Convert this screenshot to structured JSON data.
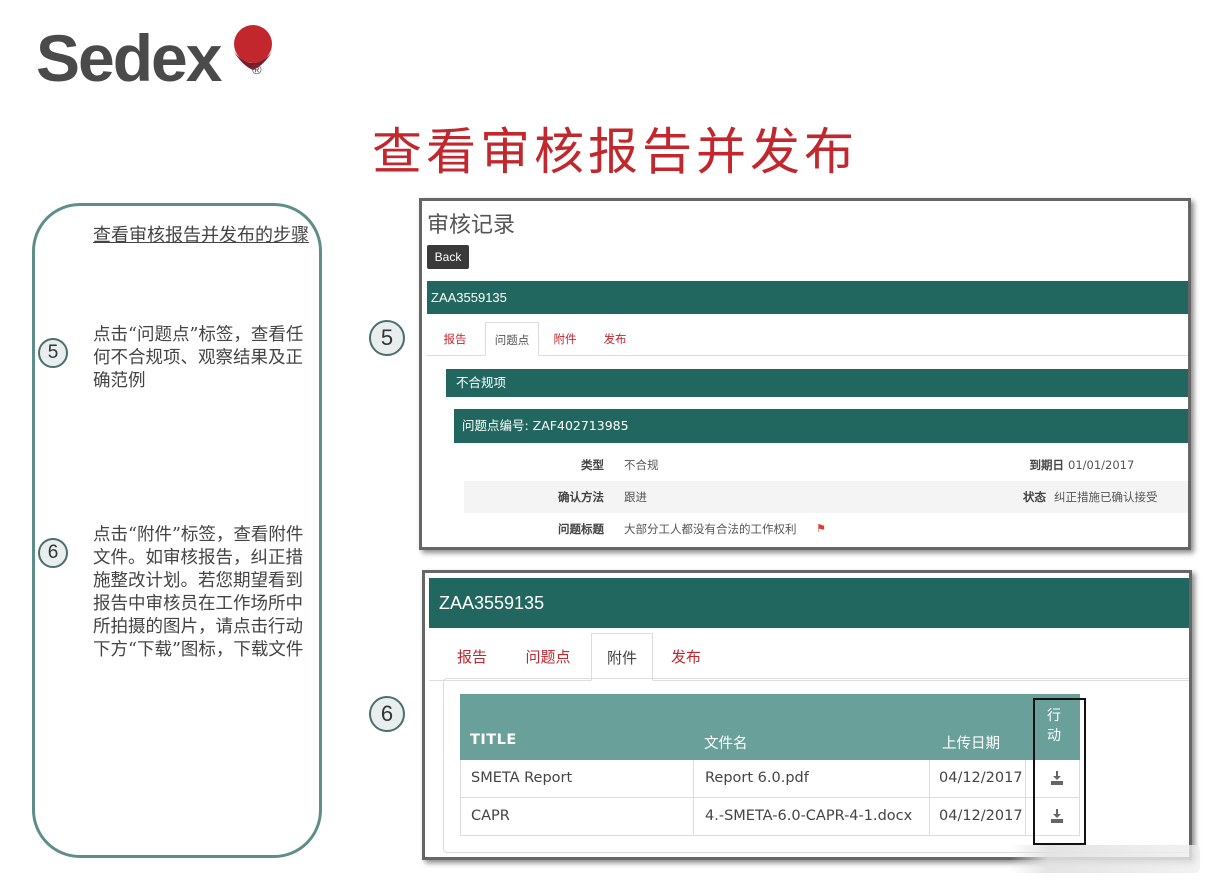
{
  "logo": {
    "text": "Sedex",
    "reg": "®"
  },
  "title": "查看审核报告并发布",
  "steps_panel": {
    "heading": "查看审核报告并发布的步骤",
    "steps": [
      {
        "num": "5",
        "text": "点击“问题点”标签，查看任何不合规项、观察结果及正确范例"
      },
      {
        "num": "6",
        "text": "点击“附件”标签，查看附件文件。如审核报告，纠正措施整改计划。若您期望看到报告中审核员在工作场所中所拍摄的图片，请点击行动下方“下载”图标，下载文件"
      }
    ]
  },
  "markers": [
    "5",
    "6"
  ],
  "shot1": {
    "page_title": "审核记录",
    "back_label": "Back",
    "audit_id": "ZAA3559135",
    "tabs": [
      "报告",
      "问题点",
      "附件",
      "发布"
    ],
    "active_tab": "问题点",
    "section_title": "不合规项",
    "issue_header": "问题点编号: ZAF402713985",
    "rows": [
      {
        "label": "类型",
        "value": "不合规",
        "label2": "到期日",
        "value2": "01/01/2017"
      },
      {
        "label": "确认方法",
        "value": "跟进",
        "label2": "状态",
        "value2": "纠正措施已确认接受"
      },
      {
        "label": "问题标题",
        "value": "大部分工人都没有合法的工作权利"
      }
    ]
  },
  "shot2": {
    "audit_id": "ZAA3559135",
    "tabs": [
      "报告",
      "问题点",
      "附件",
      "发布"
    ],
    "active_tab": "附件",
    "columns": [
      "TITLE",
      "文件名",
      "上传日期",
      "行动"
    ],
    "rows": [
      {
        "title": "SMETA Report",
        "filename": "Report 6.0.pdf",
        "date": "04/12/2017"
      },
      {
        "title": "CAPR",
        "filename": "4.-SMETA-6.0-CAPR-4-1.docx",
        "date": "04/12/2017"
      }
    ]
  },
  "colors": {
    "brand_red": "#c1272d",
    "header_teal": "#22675f",
    "table_head": "#6aa09a",
    "panel_border": "#5f8d8a"
  }
}
